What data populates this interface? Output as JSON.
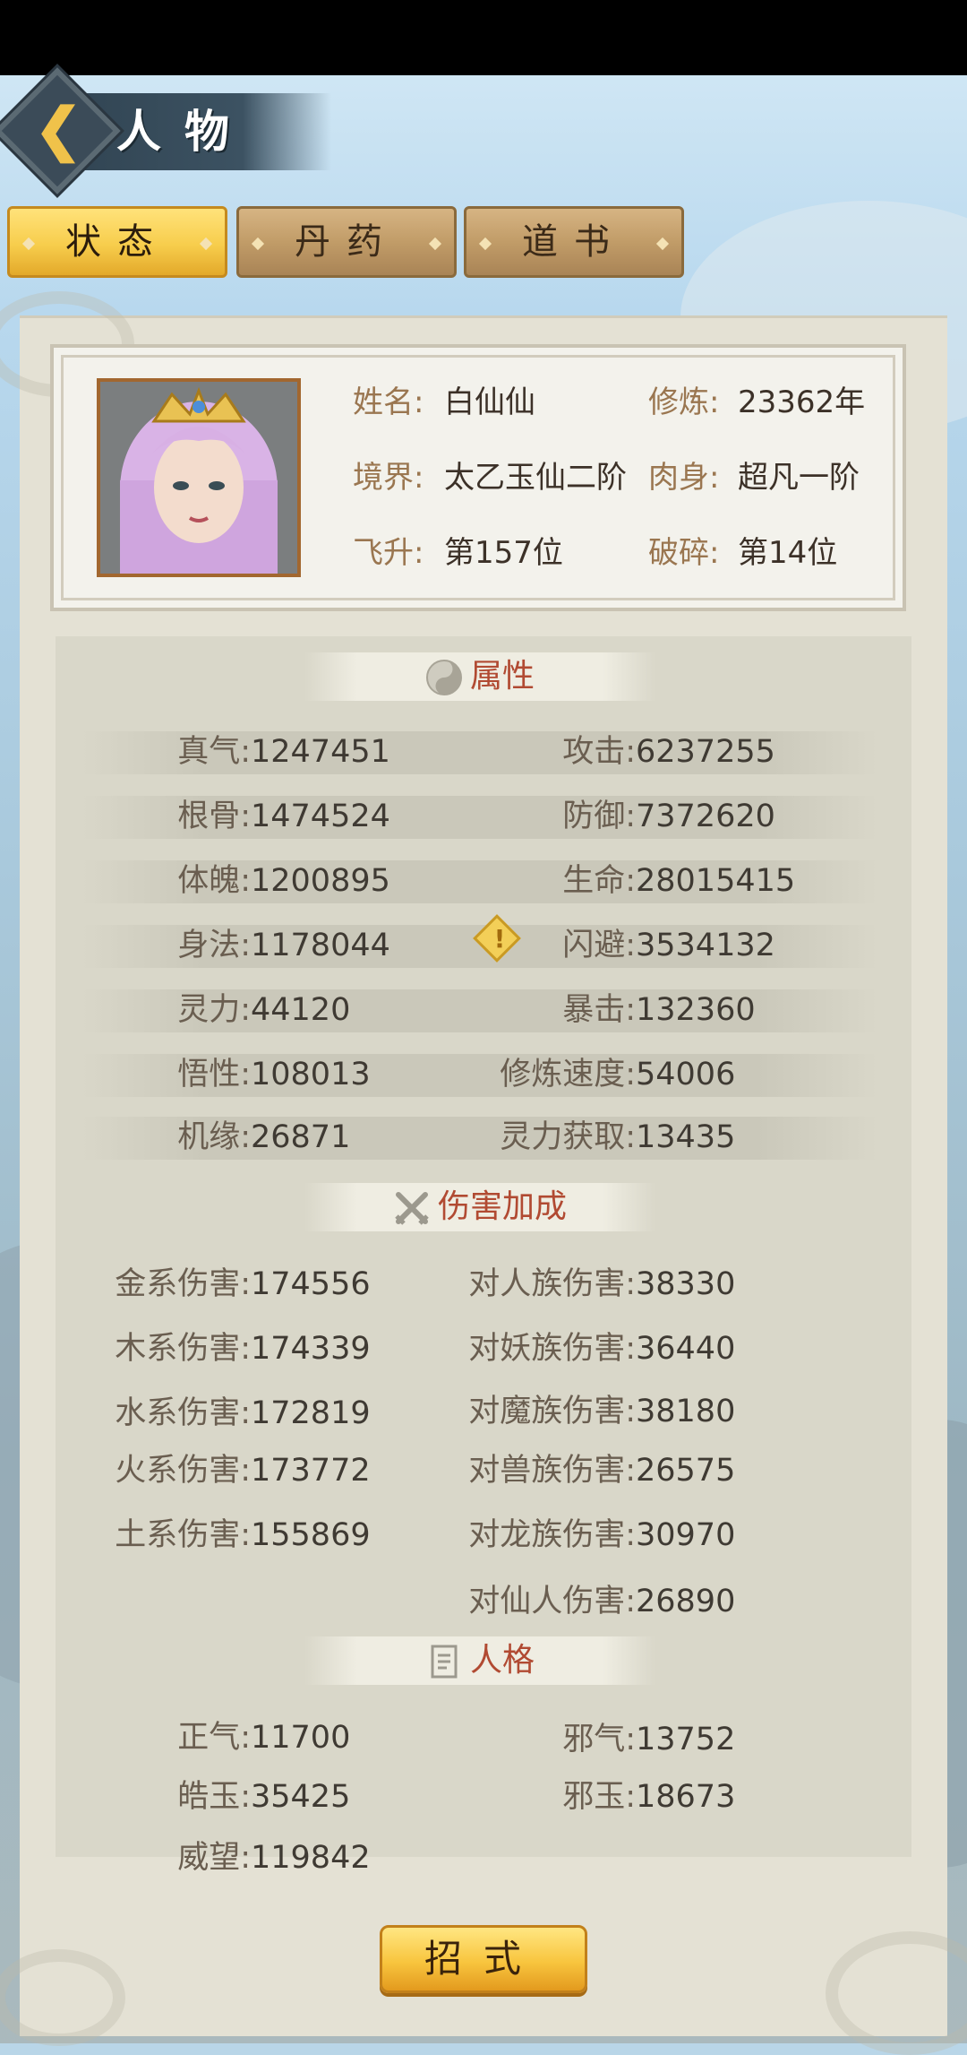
{
  "header": {
    "title": "人物",
    "back_icon": "chevron-left-icon"
  },
  "tabs": [
    {
      "label": "状态",
      "active": true
    },
    {
      "label": "丹药",
      "active": false
    },
    {
      "label": "道书",
      "active": false
    }
  ],
  "profile": {
    "name_label": "姓名:",
    "name": "白仙仙",
    "cultivation_label": "修炼:",
    "cultivation": "23362年",
    "realm_label": "境界:",
    "realm": "太乙玉仙二阶",
    "body_label": "肉身:",
    "body": "超凡一阶",
    "ascend_label": "飞升:",
    "ascend": "第157位",
    "shatter_label": "破碎:",
    "shatter": "第14位"
  },
  "attributes": {
    "title": "属性",
    "left": [
      {
        "label": "真气:",
        "value": "1247451"
      },
      {
        "label": "根骨:",
        "value": "1474524"
      },
      {
        "label": "体魄:",
        "value": "1200895"
      },
      {
        "label": "身法:",
        "value": "1178044"
      },
      {
        "label": "灵力:",
        "value": "44120"
      },
      {
        "label": "悟性:",
        "value": "108013"
      },
      {
        "label": "机缘:",
        "value": "26871"
      }
    ],
    "right": [
      {
        "label": "攻击:",
        "value": "6237255"
      },
      {
        "label": "防御:",
        "value": "7372620"
      },
      {
        "label": "生命:",
        "value": "28015415"
      },
      {
        "label": "闪避:",
        "value": "3534132"
      },
      {
        "label": "暴击:",
        "value": "132360"
      },
      {
        "label": "修炼速度:",
        "value": "54006"
      },
      {
        "label": "灵力获取:",
        "value": "13435"
      }
    ]
  },
  "damage": {
    "title": "伤害加成",
    "left": [
      {
        "label": "金系伤害:",
        "value": "174556"
      },
      {
        "label": "木系伤害:",
        "value": "174339"
      },
      {
        "label": "水系伤害:",
        "value": "172819"
      },
      {
        "label": "火系伤害:",
        "value": "173772"
      },
      {
        "label": "土系伤害:",
        "value": "155869"
      }
    ],
    "right": [
      {
        "label": "对人族伤害:",
        "value": "38330"
      },
      {
        "label": "对妖族伤害:",
        "value": "36440"
      },
      {
        "label": "对魔族伤害:",
        "value": "38180"
      },
      {
        "label": "对兽族伤害:",
        "value": "26575"
      },
      {
        "label": "对龙族伤害:",
        "value": "30970"
      },
      {
        "label": "对仙人伤害:",
        "value": "26890"
      }
    ]
  },
  "personality": {
    "title": "人格",
    "left": [
      {
        "label": "正气:",
        "value": "11700"
      },
      {
        "label": "皓玉:",
        "value": "35425"
      },
      {
        "label": "威望:",
        "value": "119842"
      }
    ],
    "right": [
      {
        "label": "邪气:",
        "value": "13752"
      },
      {
        "label": "邪玉:",
        "value": "18673"
      }
    ]
  },
  "bottom_button": {
    "label": "招式"
  },
  "colors": {
    "accent_gold": "#f7cd4c",
    "section_red": "#b14a32",
    "label_brown": "#9a7650"
  }
}
